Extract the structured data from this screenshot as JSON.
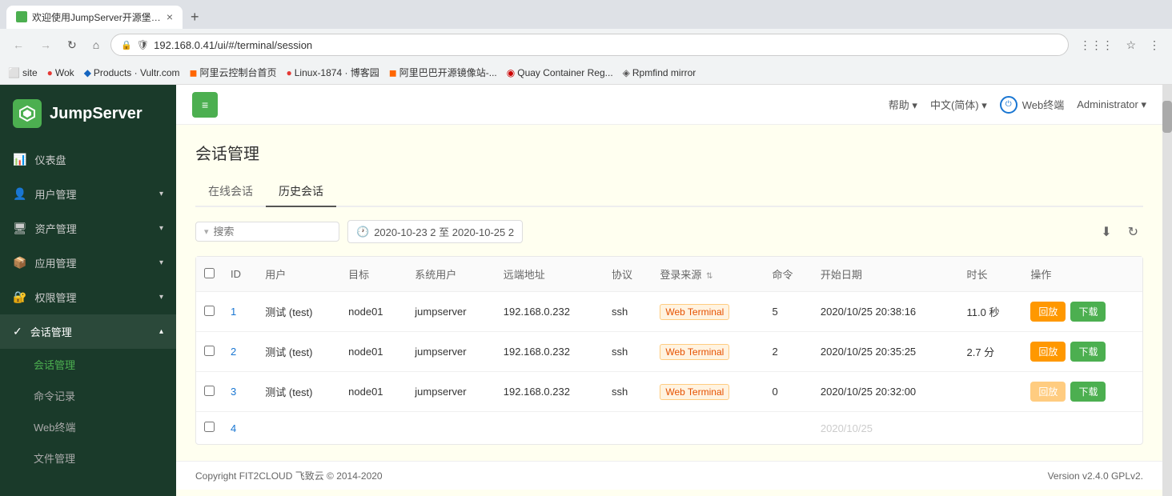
{
  "browser": {
    "tab_title": "欢迎使用JumpServer开源堡垒...",
    "tab_close": "×",
    "new_tab": "+",
    "address": "192.168.0.41/ui/#/terminal/session",
    "bookmarks": [
      {
        "label": "site",
        "color": "#888"
      },
      {
        "label": "Wok",
        "color": "#e53935"
      },
      {
        "label": "Products · Vultr.com",
        "color": "#1565c0"
      },
      {
        "label": "阿里云控制台首页",
        "color": "#ff6600"
      },
      {
        "label": "Linux-1874 · 博客园",
        "color": "#e53935"
      },
      {
        "label": "阿里巴巴开源镜像站-...",
        "color": "#ff6600"
      },
      {
        "label": "Quay Container Reg...",
        "color": "#cc0000"
      },
      {
        "label": "Rpmfind mirror",
        "color": "#555"
      }
    ]
  },
  "sidebar": {
    "logo_text": "JumpServer",
    "items": [
      {
        "label": "仪表盘",
        "icon": "📊",
        "has_arrow": false,
        "active": false
      },
      {
        "label": "用户管理",
        "icon": "👤",
        "has_arrow": true,
        "active": false
      },
      {
        "label": "资产管理",
        "icon": "🖥",
        "has_arrow": true,
        "active": false
      },
      {
        "label": "应用管理",
        "icon": "📦",
        "has_arrow": true,
        "active": false
      },
      {
        "label": "权限管理",
        "icon": "🔐",
        "has_arrow": true,
        "active": false
      },
      {
        "label": "会话管理",
        "icon": "💬",
        "has_arrow": true,
        "active": true
      }
    ],
    "sub_items": [
      {
        "label": "会话管理",
        "active": true
      },
      {
        "label": "命令记录",
        "active": false
      },
      {
        "label": "Web终端",
        "active": false
      },
      {
        "label": "文件管理",
        "active": false
      }
    ]
  },
  "header": {
    "menu_toggle": "≡",
    "help": "帮助",
    "lang": "中文(简体)",
    "terminal": "Web终端",
    "user": "Administrator"
  },
  "page": {
    "title": "会话管理",
    "tabs": [
      {
        "label": "在线会话",
        "active": false
      },
      {
        "label": "历史会话",
        "active": true
      }
    ]
  },
  "toolbar": {
    "search_placeholder": "搜索",
    "date_range": "2020-10-23 2 至 2020-10-25 2",
    "download_icon": "⬇",
    "refresh_icon": "↻"
  },
  "table": {
    "columns": [
      "",
      "ID",
      "用户",
      "目标",
      "系统用户",
      "远端地址",
      "协议",
      "登录来源",
      "命令",
      "开始日期",
      "时长",
      "操作"
    ],
    "rows": [
      {
        "id": "1",
        "user": "测试 (test)",
        "target": "node01",
        "sys_user": "jumpserver",
        "remote_addr": "192.168.0.232",
        "protocol": "ssh",
        "login_source": "Web Terminal",
        "command": "5",
        "start_date": "2020/10/25 20:38:16",
        "duration": "11.0 秒",
        "can_play": true,
        "can_download": true
      },
      {
        "id": "2",
        "user": "测试 (test)",
        "target": "node01",
        "sys_user": "jumpserver",
        "remote_addr": "192.168.0.232",
        "protocol": "ssh",
        "login_source": "Web Terminal",
        "command": "2",
        "start_date": "2020/10/25 20:35:25",
        "duration": "2.7 分",
        "can_play": true,
        "can_download": true
      },
      {
        "id": "3",
        "user": "测试 (test)",
        "target": "node01",
        "sys_user": "jumpserver",
        "remote_addr": "192.168.0.232",
        "protocol": "ssh",
        "login_source": "Web Terminal",
        "command": "0",
        "start_date": "2020/10/25 20:32:00",
        "duration": "",
        "can_play": false,
        "can_download": true
      },
      {
        "id": "4",
        "user": "",
        "target": "",
        "sys_user": "",
        "remote_addr": "",
        "protocol": "",
        "login_source": "",
        "command": "",
        "start_date": "2020/10/25",
        "duration": "",
        "can_play": false,
        "can_download": false
      }
    ],
    "btn_play": "回放",
    "btn_download": "下载"
  },
  "footer": {
    "copyright": "Copyright FIT2CLOUD 飞致云 © 2014-2020",
    "version": "Version v2.4.0 GPLv2."
  }
}
